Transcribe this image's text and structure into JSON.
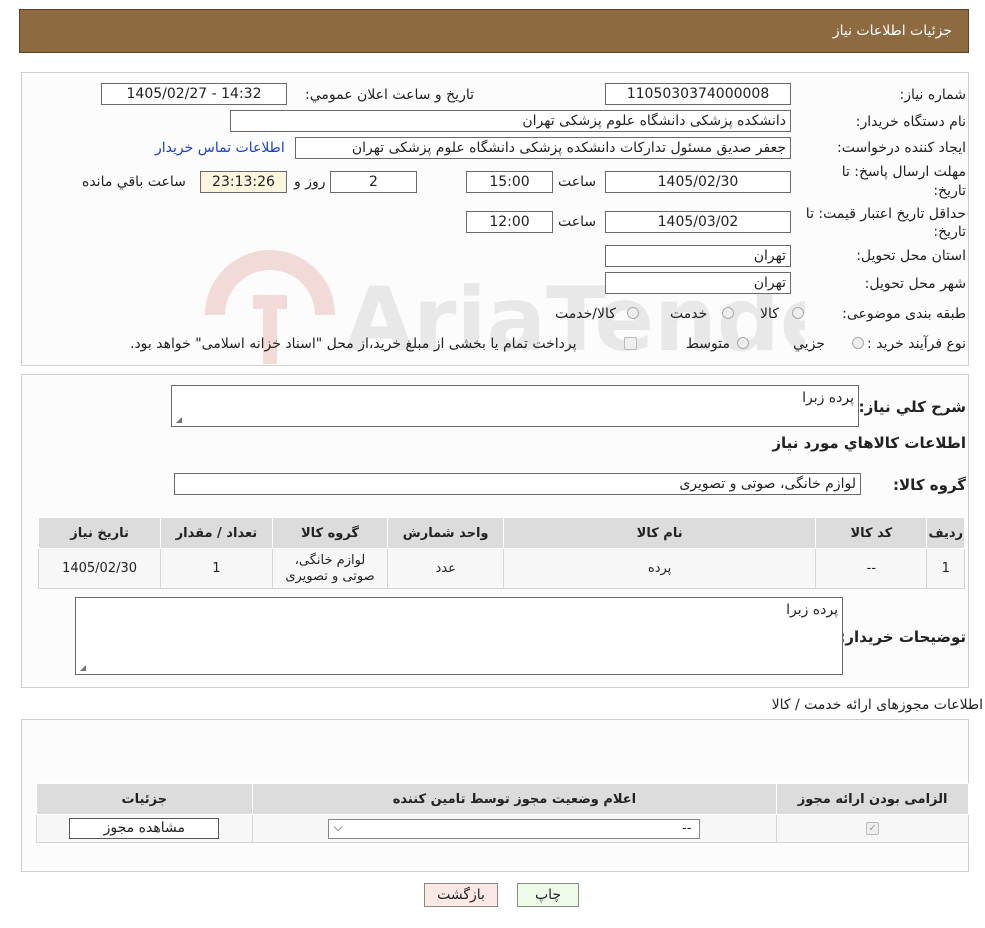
{
  "header": {
    "title": "جزئیات اطلاعات نیاز"
  },
  "form": {
    "need_number_label": "شماره نیاز:",
    "need_number": "1105030374000008",
    "announce_label": "تاریخ و ساعت اعلان عمومي:",
    "announce_value": "1405/02/27 - 14:32",
    "buyer_label": "نام دستگاه خریدار:",
    "buyer_value": "دانشکده پزشکی دانشگاه علوم پزشکی تهران",
    "creator_label": "ایجاد کننده درخواست:",
    "creator_value": "جعفر صدیق مسئول تداركات دانشکده پزشکی دانشگاه علوم پزشکی تهران",
    "contact_link": "اطلاعات تماس خریدار",
    "reply_deadline_label_1": "مهلت ارسال پاسخ: تا",
    "reply_deadline_label_2": "تاریخ:",
    "reply_date": "1405/02/30",
    "time_label": "ساعت",
    "reply_time": "15:00",
    "days_value": "2",
    "days_label": "روز و",
    "remaining_time": "23:13:26",
    "remaining_label": "ساعت باقي مانده",
    "validity_label_1": "حداقل تاریخ اعتبار قیمت: تا",
    "validity_label_2": "تاریخ:",
    "validity_date": "1405/03/02",
    "validity_time": "12:00",
    "province_label": "استان محل تحویل:",
    "province_value": "تهران",
    "city_label": "شهر محل تحویل:",
    "city_value": "تهران",
    "category_label": "طبقه بندی موضوعی:",
    "category_options": [
      "کالا",
      "خدمت",
      "کالا/خدمت"
    ],
    "process_label": "نوع فرآیند خرید :",
    "process_options": [
      "جزیي",
      "متوسط"
    ],
    "process_note": "پرداخت تمام یا بخشی از مبلغ خرید،از محل \"اسناد خزانه اسلامی\" خواهد بود."
  },
  "description": {
    "label": "شرح کلي نیاز:",
    "value": "پرده زبرا",
    "goods_title": "اطلاعات کالاهاي مورد نیاز",
    "group_label": "گروه کالا:",
    "group_value": "لوازم خانگی، صوتی و تصویری"
  },
  "goods_table": {
    "headers": [
      "ردیف",
      "کد کالا",
      "نام کالا",
      "واحد شمارش",
      "گروه کالا",
      "تعداد / مقدار",
      "تاریخ نیاز"
    ],
    "row": {
      "index": "1",
      "code": "--",
      "name": "پرده",
      "unit": "عدد",
      "group_line1": "لوازم خانگی،",
      "group_line2": "صوتی و تصویری",
      "qty": "1",
      "date": "1405/02/30"
    }
  },
  "buyer_notes": {
    "label": "توضیحات خریدار:",
    "value": "پرده زبرا"
  },
  "permits": {
    "title": "اطلاعات مجوزهای ارائه خدمت / کالا",
    "headers": [
      "الزامی بودن ارائه مجوز",
      "اعلام وضعیت مجوز توسط تامین کننده",
      "جزئیات"
    ],
    "select_value": "--",
    "view_button": "مشاهده مجوز"
  },
  "buttons": {
    "print": "چاپ",
    "back": "بازگشت"
  },
  "watermark": {
    "text": "AriaTender.neT"
  },
  "colors": {
    "header_bg": "#8d6a3f",
    "link": "#1a3ecf",
    "print_bg": "#eefbe8",
    "back_bg": "#fde8e6"
  }
}
